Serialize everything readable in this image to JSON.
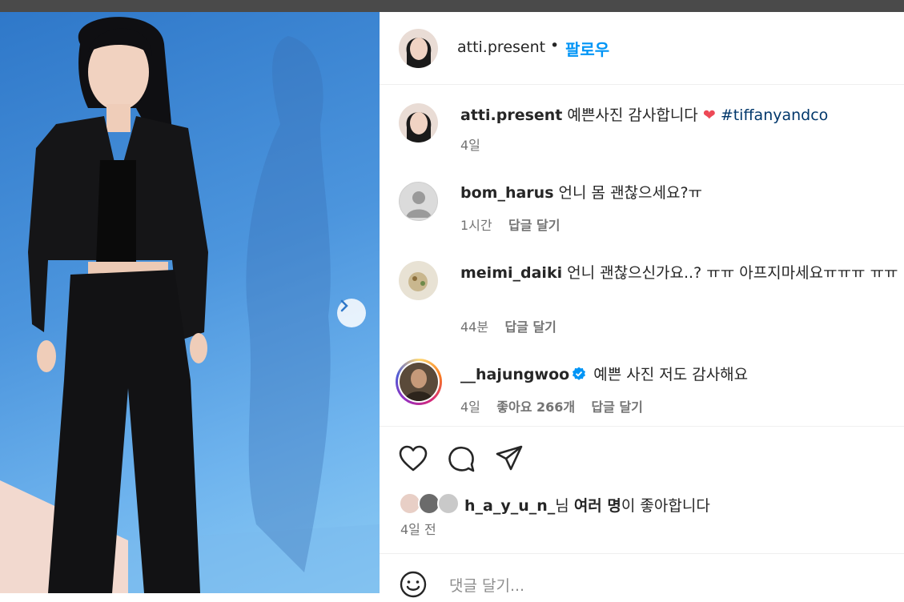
{
  "post": {
    "username": "atti.present",
    "follow_label": "팔로우",
    "separator": "•"
  },
  "caption": {
    "username": "atti.present",
    "text": " 예쁜사진 감사합니다 ",
    "heart": "❤",
    "hashtag": "#tiffanyandco",
    "time": "4일"
  },
  "comments": [
    {
      "username": "bom_harus",
      "text": " 언니 몸 괜찮으세요?ㅠ",
      "time": "1시간",
      "reply_label": "답글 달기"
    },
    {
      "username": "meimi_daiki",
      "text": " 언니 괜찮으신가요..? ㅠㅠ 아프지마세요ㅠㅠㅠ ㅠㅠ",
      "time": "44분",
      "reply_label": "답글 달기"
    },
    {
      "username": "__hajungwoo",
      "verified": true,
      "text": " 예쁜 사진 저도 감사해요",
      "time": "4일",
      "likes_label": "좋아요 266개",
      "reply_label": "답글 달기"
    }
  ],
  "actions": {
    "like_icon": "heart-icon",
    "comment_icon": "comment-icon",
    "share_icon": "send-icon"
  },
  "liked_by": {
    "username": "h_a_y_u_n_",
    "suffix1": "님 ",
    "others": "여러 명",
    "suffix2": "이 좋아합니다"
  },
  "post_date": "4일 전",
  "comment_input": {
    "placeholder": "댓글 달기..."
  },
  "colors": {
    "accent": "#0095f6",
    "hashtag": "#00376b",
    "heart": "#ed4956",
    "muted": "#737373"
  }
}
